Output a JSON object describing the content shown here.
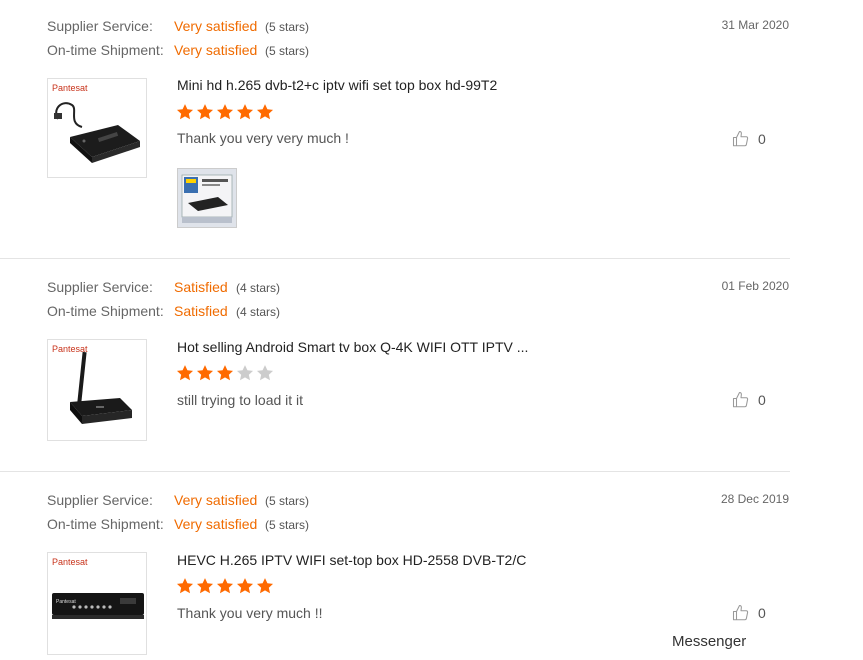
{
  "labels": {
    "supplier_service": "Supplier Service:",
    "ontime_shipment": "On-time Shipment:"
  },
  "reviews": [
    {
      "supplier_rating": "Very satisfied",
      "supplier_stars": "(5 stars)",
      "shipment_rating": "Very satisfied",
      "shipment_stars": "(5 stars)",
      "date": "31 Mar 2020",
      "brand": "Pantesat",
      "product_title": "Mini hd h.265 dvb-t2+c iptv wifi set top box hd-99T2",
      "rating": 5,
      "comment": "Thank you very very much !",
      "likes": "0",
      "has_photo": true
    },
    {
      "supplier_rating": "Satisfied",
      "supplier_stars": "(4 stars)",
      "shipment_rating": "Satisfied",
      "shipment_stars": "(4 stars)",
      "date": "01 Feb 2020",
      "brand": "Pantesat",
      "product_title": "Hot selling Android Smart tv box Q-4K WIFI OTT IPTV ...",
      "rating": 3,
      "comment": "still trying to load it it",
      "likes": "0",
      "has_photo": false
    },
    {
      "supplier_rating": "Very satisfied",
      "supplier_stars": "(5 stars)",
      "shipment_rating": "Very satisfied",
      "shipment_stars": "(5 stars)",
      "date": "28 Dec 2019",
      "brand": "Pantesat",
      "product_title": "HEVC H.265 IPTV WIFI set-top box HD-2558 DVB-T2/C",
      "rating": 5,
      "comment": "Thank you very much !!",
      "likes": "0",
      "has_photo": false
    }
  ],
  "messenger": "Messenger",
  "colors": {
    "accent": "#f06b00",
    "star_on": "#ff6a00",
    "star_off": "#cccccc",
    "divider": "#e4e4e4"
  },
  "icons": {
    "like": "thumbs-up-icon",
    "star": "star-icon"
  }
}
